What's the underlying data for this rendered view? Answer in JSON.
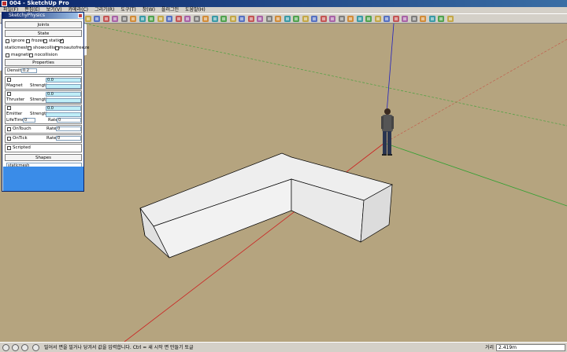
{
  "window": {
    "title": "004 - SketchUp Pro"
  },
  "menu": [
    "파일(F)",
    "편집(E)",
    "보기(V)",
    "카메라(C)",
    "그리기(R)",
    "도구(T)",
    "창(W)",
    "플러그인",
    "도움말(H)"
  ],
  "toolbar": {
    "icons": [
      "select-icon",
      "make-component-icon",
      "paint-bucket-icon",
      "eraser-icon",
      "rectangle-icon",
      "line-icon",
      "circle-icon",
      "arc-icon",
      "polygon-icon",
      "freehand-icon",
      "move-icon",
      "push-pull-icon",
      "rotate-icon",
      "follow-me-icon",
      "scale-icon",
      "offset-icon",
      "tape-measure-icon",
      "dimension-icon",
      "protractor-icon",
      "text-icon",
      "axes-icon",
      "3d-text-icon",
      "orbit-icon",
      "pan-icon",
      "zoom-icon",
      "zoom-window-icon",
      "zoom-extents-icon",
      "previous-icon",
      "next-icon",
      "iso-view-icon",
      "top-view-icon",
      "front-view-icon",
      "right-view-icon",
      "back-view-icon",
      "left-view-icon",
      "xray-icon",
      "back-edges-icon",
      "wireframe-icon",
      "hidden-line-icon",
      "shaded-icon",
      "shaded-textures-icon",
      "monochrome-icon",
      "sandbox-icon",
      "warehouse-icon",
      "position-camera-icon",
      "walk-icon",
      "look-around-icon",
      "section-plane-icon",
      "play-icon",
      "rewind-icon"
    ]
  },
  "plugin_dialog": {
    "title": "SketchyPhysics",
    "joints_label": "Joints",
    "state_label": "State",
    "state_options": [
      {
        "label": "ignore",
        "checked": false
      },
      {
        "label": "frozen",
        "checked": false
      },
      {
        "label": "static",
        "checked": true
      },
      {
        "label": "staticmesh",
        "checked": false
      },
      {
        "label": "showcollision",
        "checked": false
      },
      {
        "label": "noautofreeze",
        "checked": false
      },
      {
        "label": "magnetic",
        "checked": false
      },
      {
        "label": "nocollision",
        "checked": false
      }
    ],
    "properties_label": "Properties",
    "density_label": "Density",
    "density_value": "0.2",
    "magnet": {
      "label": "Magnet",
      "strength_label": "Strength",
      "value": "0.0"
    },
    "thruster": {
      "label": "Thruster",
      "strength_label": "Strength",
      "value": "0.0"
    },
    "emitter": {
      "label": "Emitter",
      "strength_label": "Strength",
      "value": "0.0"
    },
    "lifetime_label": "LifeTime",
    "lifetime_value": "0",
    "rate_label": "Rate",
    "rate_value": "0",
    "ontouch": {
      "label": "OnTouch",
      "rate_label": "Rate",
      "value": "0"
    },
    "ontick": {
      "label": "OnTick",
      "rate_label": "Rate",
      "value": "0"
    },
    "scripted_label": "Scripted",
    "shapes_label": "Shapes",
    "shapes_value": "staticmesh"
  },
  "status": {
    "message": "밀어서 면을 밀거나 당겨서 값을 입력합니다.  Ctrl = 새 시작 면 만들기 토글",
    "measure_label": "거리",
    "measure_value": "2.419m"
  },
  "colors": {
    "ground": "#b5a47f",
    "face": "#eeeeee",
    "x_axis": "#cc2020",
    "y_axis": "#30a030",
    "z_axis": "#2020c0"
  }
}
